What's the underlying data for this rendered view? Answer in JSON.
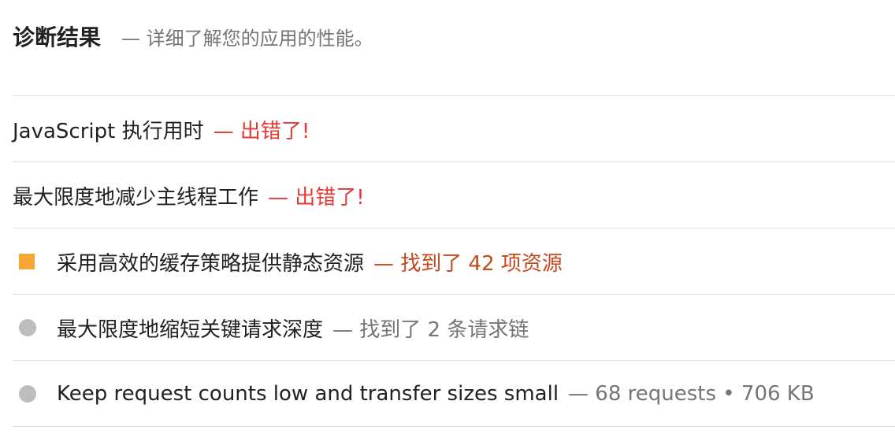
{
  "header": {
    "title": "诊断结果",
    "description": "— 详细了解您的应用的性能。"
  },
  "colors": {
    "fail": "#e53935",
    "warn_text": "#c6491c",
    "warn_marker": "#f4a735",
    "info_marker": "#bdbdbd",
    "divider": "#e0e0e0"
  },
  "audits": [
    {
      "title": "JavaScript 执行用时",
      "status": "fail",
      "detail": "— 出错了!"
    },
    {
      "title": "最大限度地减少主线程工作",
      "status": "fail",
      "detail": "— 出错了!"
    },
    {
      "title": "采用高效的缓存策略提供静态资源",
      "status": "warn",
      "marker_icon": "square-warning-icon",
      "detail": "— 找到了 42 项资源"
    },
    {
      "title": "最大限度地缩短关键请求深度",
      "status": "info",
      "marker_icon": "circle-info-icon",
      "detail": "— 找到了 2 条请求链"
    },
    {
      "title": "Keep request counts low and transfer sizes small",
      "status": "info",
      "marker_icon": "circle-info-icon",
      "detail": "— 68 requests • 706 KB"
    }
  ]
}
